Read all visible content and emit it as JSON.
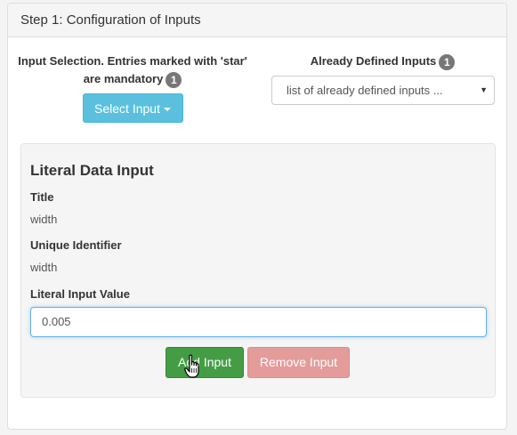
{
  "header": {
    "title": "Step 1: Configuration of Inputs"
  },
  "input_selection": {
    "label": "Input Selection. Entries marked with 'star' are mandatory",
    "badge": "1",
    "button_label": "Select Input"
  },
  "defined_inputs": {
    "label": "Already Defined Inputs",
    "badge": "1",
    "select_value": "list of already defined inputs ..."
  },
  "literal_input": {
    "heading": "Literal Data Input",
    "title_label": "Title",
    "title_value": "width",
    "identifier_label": "Unique Identifier",
    "identifier_value": "width",
    "value_label": "Literal Input Value",
    "value": "0.005",
    "add_button": "Add Input",
    "remove_button": "Remove Input"
  },
  "colors": {
    "info": "#5bc0de",
    "success": "#449d44",
    "danger_disabled": "#e39c9a",
    "badge": "#777777"
  },
  "icons": [
    "caret-down-icon",
    "dropdown-arrow-icon",
    "hand-pointer-cursor-icon"
  ]
}
